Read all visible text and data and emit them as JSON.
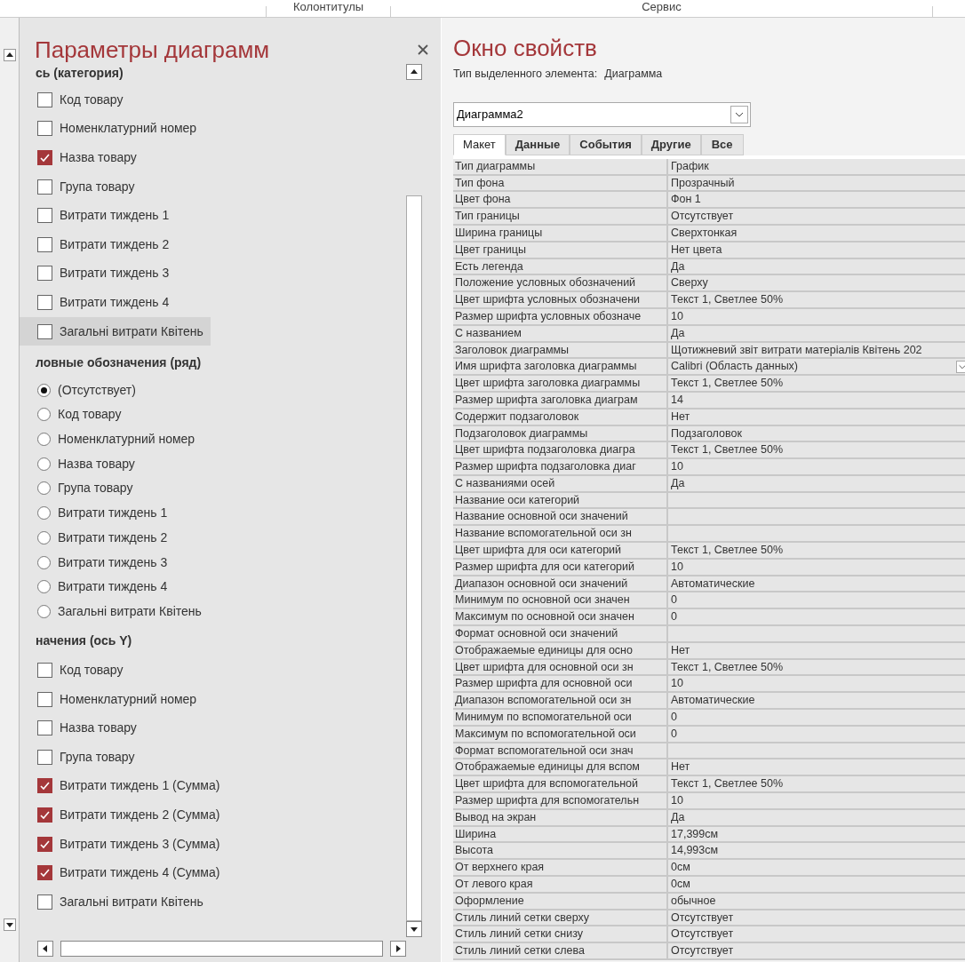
{
  "ribbon": {
    "groups": [
      "Колонтитулы",
      "Сервис"
    ]
  },
  "chart_panel": {
    "title": "Параметры диаграмм",
    "sections": [
      {
        "heading": "сь (категория)",
        "kind": "checkbox",
        "items": [
          {
            "label": "Код товару",
            "checked": false,
            "highlighted": false
          },
          {
            "label": "Номенклатурний номер",
            "checked": false,
            "highlighted": false
          },
          {
            "label": "Назва товару",
            "checked": true,
            "highlighted": false
          },
          {
            "label": "Група товару",
            "checked": false,
            "highlighted": false
          },
          {
            "label": "Витрати тиждень 1",
            "checked": false,
            "highlighted": false
          },
          {
            "label": "Витрати тиждень 2",
            "checked": false,
            "highlighted": false
          },
          {
            "label": "Витрати тиждень 3",
            "checked": false,
            "highlighted": false
          },
          {
            "label": "Витрати тиждень 4",
            "checked": false,
            "highlighted": false
          },
          {
            "label": "Загальні витрати Квітень",
            "checked": false,
            "highlighted": true
          }
        ]
      },
      {
        "heading": "ловные обозначения (ряд)",
        "kind": "radio",
        "items": [
          {
            "label": "(Отсутствует)",
            "selected": true
          },
          {
            "label": "Код товару",
            "selected": false
          },
          {
            "label": "Номенклатурний номер",
            "selected": false
          },
          {
            "label": "Назва товару",
            "selected": false
          },
          {
            "label": "Група товару",
            "selected": false
          },
          {
            "label": "Витрати тиждень 1",
            "selected": false
          },
          {
            "label": "Витрати тиждень 2",
            "selected": false
          },
          {
            "label": "Витрати тиждень 3",
            "selected": false
          },
          {
            "label": "Витрати тиждень 4",
            "selected": false
          },
          {
            "label": "Загальні витрати Квітень",
            "selected": false
          }
        ]
      },
      {
        "heading": "начения (ось Y)",
        "kind": "checkbox",
        "items": [
          {
            "label": "Код товару",
            "checked": false,
            "highlighted": false
          },
          {
            "label": "Номенклатурний номер",
            "checked": false,
            "highlighted": false
          },
          {
            "label": "Назва товару",
            "checked": false,
            "highlighted": false
          },
          {
            "label": "Група товару",
            "checked": false,
            "highlighted": false
          },
          {
            "label": "Витрати тиждень 1 (Сумма)",
            "checked": true,
            "highlighted": false
          },
          {
            "label": "Витрати тиждень 2 (Сумма)",
            "checked": true,
            "highlighted": false
          },
          {
            "label": "Витрати тиждень 3 (Сумма)",
            "checked": true,
            "highlighted": false
          },
          {
            "label": "Витрати тиждень 4 (Сумма)",
            "checked": true,
            "highlighted": false
          },
          {
            "label": "Загальні витрати Квітень",
            "checked": false,
            "highlighted": false
          }
        ]
      }
    ]
  },
  "property_sheet": {
    "title": "Окно свойств",
    "selection_type_label": "Тип выделенного элемента:",
    "selection_type": "Диаграмма",
    "object": "Диаграмма2",
    "tabs": [
      {
        "label": "Макет",
        "selected": true
      },
      {
        "label": "Данные",
        "selected": false
      },
      {
        "label": "События",
        "selected": false
      },
      {
        "label": "Другие",
        "selected": false
      },
      {
        "label": "Все",
        "selected": false
      }
    ],
    "rows": [
      {
        "name": "Тип диаграммы",
        "value": "График"
      },
      {
        "name": "Тип фона",
        "value": "Прозрачный"
      },
      {
        "name": "Цвет фона",
        "value": "Фон 1"
      },
      {
        "name": "Тип границы",
        "value": "Отсутствует"
      },
      {
        "name": "Ширина границы",
        "value": "Сверхтонкая"
      },
      {
        "name": "Цвет границы",
        "value": "Нет цвета"
      },
      {
        "name": "Есть легенда",
        "value": "Да"
      },
      {
        "name": "Положение условных обозначений",
        "value": "Сверху"
      },
      {
        "name": "Цвет шрифта условных обозначени",
        "value": "Текст 1, Светлее 50%"
      },
      {
        "name": "Размер шрифта условных обозначе",
        "value": "10"
      },
      {
        "name": "С названием",
        "value": "Да"
      },
      {
        "name": "Заголовок диаграммы",
        "value": "Щотижневий звіт витрати матеріалів Квітень 202"
      },
      {
        "name": "Имя шрифта заголовка диаграммы",
        "value": "Calibri (Область данных)",
        "kind": "dropdown"
      },
      {
        "name": "Цвет шрифта заголовка диаграммы",
        "value": "Текст 1, Светлее 50%"
      },
      {
        "name": "Размер шрифта заголовка диаграм",
        "value": "14"
      },
      {
        "name": "Содержит подзаголовок",
        "value": "Нет"
      },
      {
        "name": "Подзаголовок диаграммы",
        "value": "Подзаголовок"
      },
      {
        "name": "Цвет шрифта подзаголовка диагра",
        "value": "Текст 1, Светлее 50%"
      },
      {
        "name": "Размер шрифта подзаголовка диаг",
        "value": "10"
      },
      {
        "name": "С названиями осей",
        "value": "Да"
      },
      {
        "name": "Название оси категорий"
      },
      {
        "name": "Название основной оси значений"
      },
      {
        "name": "Название вспомогательной оси зн"
      },
      {
        "name": "Цвет шрифта для оси категорий",
        "value": "Текст 1, Светлее 50%"
      },
      {
        "name": "Размер шрифта для оси категорий",
        "value": "10"
      },
      {
        "name": "Диапазон основной оси значений",
        "value": "Автоматические"
      },
      {
        "name": "Минимум по основной оси значен",
        "value": "0"
      },
      {
        "name": "Максимум по основной оси значен",
        "value": "0"
      },
      {
        "name": "Формат основной оси значений"
      },
      {
        "name": "Отображаемые единицы для осно",
        "value": "Нет"
      },
      {
        "name": "Цвет шрифта для основной оси зн",
        "value": "Текст 1, Светлее 50%"
      },
      {
        "name": "Размер шрифта для основной оси",
        "value": "10"
      },
      {
        "name": "Диапазон вспомогательной оси зн",
        "value": "Автоматические"
      },
      {
        "name": "Минимум по вспомогательной оси",
        "value": "0"
      },
      {
        "name": "Максимум по вспомогательной оси",
        "value": "0"
      },
      {
        "name": "Формат вспомогательной оси знач"
      },
      {
        "name": "Отображаемые единицы для вспом",
        "value": "Нет"
      },
      {
        "name": "Цвет шрифта для вспомогательной",
        "value": "Текст 1, Светлее 50%"
      },
      {
        "name": "Размер шрифта для вспомогательн",
        "value": "10"
      },
      {
        "name": "Вывод на экран",
        "value": "Да"
      },
      {
        "name": "Ширина",
        "value": "17,399см"
      },
      {
        "name": "Высота",
        "value": "14,993см"
      },
      {
        "name": "От верхнего края",
        "value": "0см"
      },
      {
        "name": "От левого края",
        "value": "0см"
      },
      {
        "name": "Оформление",
        "value": "обычное"
      },
      {
        "name": "Стиль линий сетки сверху",
        "value": "Отсутствует"
      },
      {
        "name": "Стиль линий сетки снизу",
        "value": "Отсутствует"
      },
      {
        "name": "Стиль линий сетки слева",
        "value": "Отсутствует"
      }
    ]
  }
}
